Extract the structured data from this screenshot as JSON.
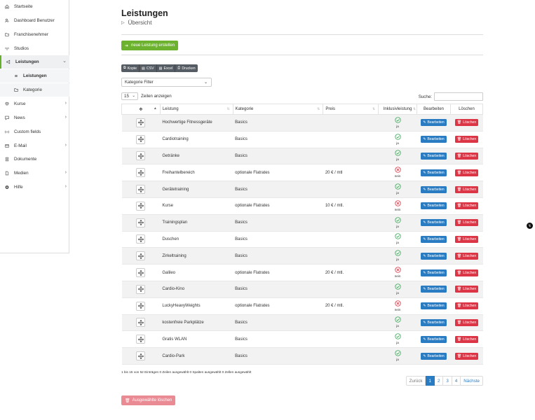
{
  "sidebar": {
    "items": [
      {
        "label": "Startseite",
        "icon": "home-icon",
        "chev": false
      },
      {
        "label": "Dashboard Benutzer",
        "icon": "user-icon",
        "chev": false
      },
      {
        "label": "Franchisenehmer",
        "icon": "folder-icon",
        "chev": false
      },
      {
        "label": "Studios",
        "icon": "broadcast-icon",
        "chev": false
      },
      {
        "label": "Leistungen",
        "icon": "megaphone-icon",
        "chev": true,
        "active": true
      },
      {
        "label": "Leistungen",
        "icon": "list-icon",
        "chev": false,
        "sub": true
      },
      {
        "label": "Kategorie",
        "icon": "folder-icon",
        "chev": false,
        "sub": true
      },
      {
        "label": "Kurse",
        "icon": "layers-icon",
        "chev": true
      },
      {
        "label": "News",
        "icon": "chat-icon",
        "chev": true
      },
      {
        "label": "Custom fields",
        "icon": "radio-icon",
        "chev": false
      },
      {
        "label": "E-Mail",
        "icon": "mail-icon",
        "chev": true
      },
      {
        "label": "Dokumente",
        "icon": "document-icon",
        "chev": false
      },
      {
        "label": "Medien",
        "icon": "file-icon",
        "chev": true
      },
      {
        "label": "Hilfe",
        "icon": "lifebuoy-icon",
        "chev": true
      }
    ]
  },
  "page": {
    "title": "Leistungen",
    "subtitle": "Übersicht",
    "new_button": "neue Leistung erstellen",
    "export_buttons": [
      "Kopie",
      "CSV",
      "Excel",
      "Drucken"
    ],
    "category_filter": "Kategorie Filter",
    "length_value": "15",
    "length_label": "Zeilen anzeigen",
    "search_label": "Suche:",
    "info": "1 bis 15 von 52 Einträgen 0 Zeilen ausgewählt 0 Spalten ausgewählt 0 Zellen ausgewählt",
    "bulk_delete": "Ausgewählte löschen"
  },
  "table": {
    "headers": [
      "Leistung",
      "Kategorie",
      "Preis",
      "Inklusivleistung",
      "Bearbeiten",
      "Löschen"
    ],
    "edit_label": "Bearbeiten",
    "delete_label": "Löschen",
    "rows": [
      {
        "name": "Hochwertige Fitnessgeräte",
        "category": "Basics",
        "price": "",
        "included": true,
        "inc_label": "ja"
      },
      {
        "name": "Cardiotraining",
        "category": "Basics",
        "price": "",
        "included": true,
        "inc_label": "ja"
      },
      {
        "name": "Getränke",
        "category": "Basics",
        "price": "",
        "included": true,
        "inc_label": "ja"
      },
      {
        "name": "Freihantelbereich",
        "category": "optionale Flatrates",
        "price": "20 € / mtl",
        "included": false,
        "inc_label": "nein"
      },
      {
        "name": "Gerätetraining",
        "category": "Basics",
        "price": "",
        "included": true,
        "inc_label": "ja"
      },
      {
        "name": "Kurse",
        "category": "optionale Flatrates",
        "price": "10 € / mtl.",
        "included": false,
        "inc_label": "nein"
      },
      {
        "name": "Trainingsplan",
        "category": "Basics",
        "price": "",
        "included": true,
        "inc_label": "ja"
      },
      {
        "name": "Duschen",
        "category": "Basics",
        "price": "",
        "included": true,
        "inc_label": "ja"
      },
      {
        "name": "Zirkeltraining",
        "category": "Basics",
        "price": "",
        "included": true,
        "inc_label": "ja"
      },
      {
        "name": "Galileo",
        "category": "optionale Flatrates",
        "price": "20 € / mtl.",
        "included": false,
        "inc_label": "nein"
      },
      {
        "name": "Cardio-Kino",
        "category": "Basics",
        "price": "",
        "included": true,
        "inc_label": "ja"
      },
      {
        "name": "LuckyHeavyWeights",
        "category": "optionale Flatrates",
        "price": "20 € / mtl.",
        "included": false,
        "inc_label": "nein"
      },
      {
        "name": "kostenfreie Parkplätze",
        "category": "Basics",
        "price": "",
        "included": true,
        "inc_label": "ja"
      },
      {
        "name": "Gratis WLAN",
        "category": "Basics",
        "price": "",
        "included": true,
        "inc_label": "ja"
      },
      {
        "name": "Cardio-Park",
        "category": "Basics",
        "price": "",
        "included": true,
        "inc_label": "ja"
      }
    ]
  },
  "pagination": {
    "prev": "Zurück",
    "pages": [
      "1",
      "2",
      "3",
      "4"
    ],
    "current": "1",
    "next": "Nächste"
  },
  "colors": {
    "accent_green": "#6cb22f",
    "edit_blue": "#2a7cc2",
    "delete_red": "#dc3545",
    "check_green": "#3aa757",
    "cross_red": "#dc3545"
  }
}
